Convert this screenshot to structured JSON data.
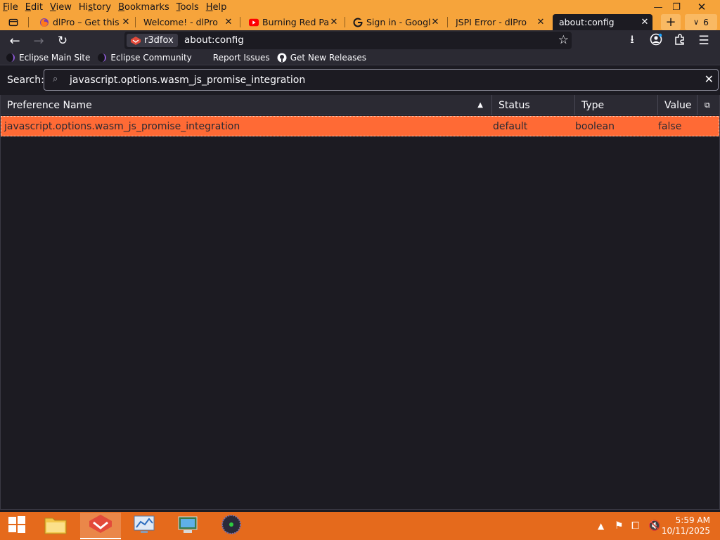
{
  "menu": [
    "File",
    "Edit",
    "View",
    "History",
    "Bookmarks",
    "Tools",
    "Help"
  ],
  "menu_access": [
    "F",
    "E",
    "V",
    "s",
    "B",
    "T",
    "H"
  ],
  "tabs": [
    {
      "label": "dlPro – Get this E",
      "icon": "firefox-icon"
    },
    {
      "label": "Welcome! - dlPro",
      "icon": "none"
    },
    {
      "label": "Burning Red Part",
      "icon": "youtube-icon"
    },
    {
      "label": "Sign in - Google A",
      "icon": "google-icon"
    },
    {
      "label": "JSPI Error - dlPro",
      "icon": "none"
    },
    {
      "label": "about:config",
      "icon": "none"
    }
  ],
  "tab_count": "6",
  "url": {
    "identity": "r3dfox",
    "address": "about:config"
  },
  "bookmarks": [
    {
      "label": "Eclipse Main Site",
      "icon": "eclipse-icon"
    },
    {
      "label": "Eclipse Community",
      "icon": "eclipse-icon"
    },
    {
      "label": "Report Issues",
      "icon": "none"
    },
    {
      "label": "Get New Releases",
      "icon": "github-icon"
    }
  ],
  "search": {
    "label": "Search:",
    "value": "javascript.options.wasm_js_promise_integration"
  },
  "table": {
    "columns": [
      "Preference Name",
      "Status",
      "Type",
      "Value"
    ],
    "rows": [
      {
        "name": "javascript.options.wasm_js_promise_integration",
        "status": "default",
        "type": "boolean",
        "value": "false"
      }
    ]
  },
  "taskbar": {
    "time": "5:59 AM",
    "date": "10/11/2025"
  },
  "colors": {
    "accent": "#f6a43b",
    "selected_row": "#ff6a35",
    "taskbar": "#e56a1c"
  }
}
